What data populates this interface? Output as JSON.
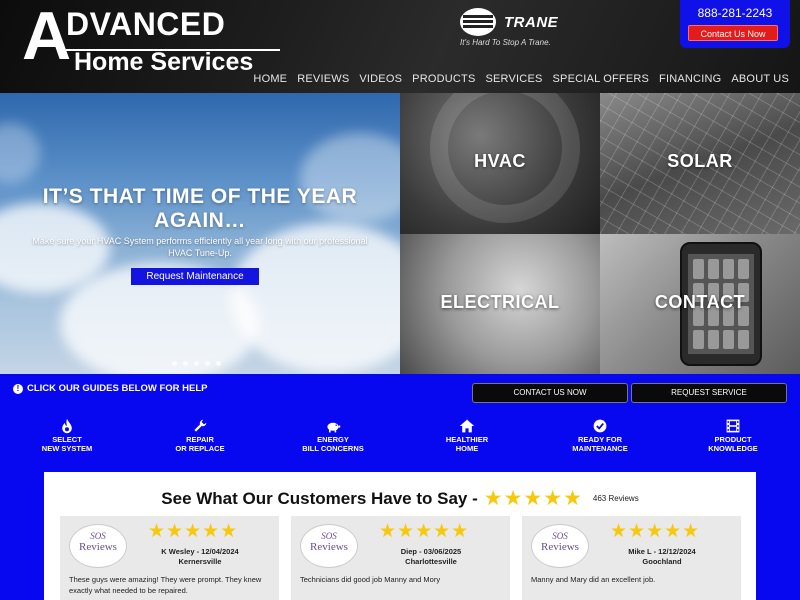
{
  "header": {
    "logo_letter": "A",
    "logo_top": "DVANCED",
    "logo_bottom": "Home Services",
    "trane_name": "TRANE",
    "trane_tagline": "It's Hard To Stop A Trane.",
    "phone": "888-281-2243",
    "contact_button": "Contact Us Now"
  },
  "nav": [
    "HOME",
    "REVIEWS",
    "VIDEOS",
    "PRODUCTS",
    "SERVICES",
    "SPECIAL OFFERS",
    "FINANCING",
    "ABOUT US"
  ],
  "hero": {
    "title": "IT’S THAT TIME OF THE YEAR AGAIN…",
    "subtitle": "Make sure your HVAC System performs efficiently all year long with our professional HVAC Tune-Up.",
    "button": "Request Maintenance",
    "slide_count": 5
  },
  "tiles": {
    "hvac": "HVAC",
    "solar": "SOLAR",
    "electrical": "ELECTRICAL",
    "contact": "CONTACT"
  },
  "band": {
    "guides_text": "CLICK OUR GUIDES BELOW FOR HELP",
    "btn_contact": "CONTACT US NOW",
    "btn_request": "REQUEST SERVICE",
    "guides": [
      {
        "icon": "flame-icon",
        "line1": "SELECT",
        "line2": "NEW SYSTEM"
      },
      {
        "icon": "wrench-icon",
        "line1": "REPAIR",
        "line2": "OR REPLACE"
      },
      {
        "icon": "piggy-bank-icon",
        "line1": "ENERGY",
        "line2": "BILL CONCERNS"
      },
      {
        "icon": "home-icon",
        "line1": "HEALTHIER",
        "line2": "HOME"
      },
      {
        "icon": "check-badge-icon",
        "line1": "READY FOR",
        "line2": "MAINTENANCE"
      },
      {
        "icon": "film-icon",
        "line1": "PRODUCT",
        "line2": "KNOWLEDGE"
      }
    ]
  },
  "reviews": {
    "title": "See What Our Customers Have to Say -",
    "stars": "★★★★★",
    "count": "463 Reviews",
    "badge_top": "SOS",
    "badge_bottom": "Reviews",
    "cards": [
      {
        "name": "K Wesley - 12/04/2024",
        "location": "Kernersville",
        "text": "These guys were amazing! They were prompt. They knew exactly what needed to be repaired."
      },
      {
        "name": "Diep - 03/06/2025",
        "location": "Charlottesville",
        "text": "Technicians did good job Manny and Mory"
      },
      {
        "name": "Mike L - 12/12/2024",
        "location": "Goochland",
        "text": "Manny and Mary did an excellent job."
      }
    ]
  },
  "colors": {
    "brand_blue": "#0808f0",
    "accent_red": "#e31b1b",
    "star_yellow": "#f6c90e"
  }
}
